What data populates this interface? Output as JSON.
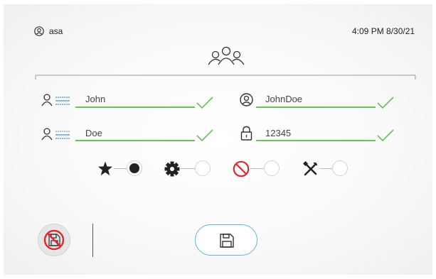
{
  "header": {
    "user_name": "asa",
    "datetime": "4:09 PM 8/30/21"
  },
  "form": {
    "first_name": "John",
    "last_name": "Doe",
    "username": "JohnDoe",
    "password": "12345"
  },
  "roles": {
    "selected": "star",
    "options": [
      "star-icon",
      "gear-icon",
      "no-entry-icon",
      "tools-icon"
    ]
  },
  "colors": {
    "valid_green": "#6abf5e",
    "accent_blue": "#5fb3e0",
    "deny_red": "#e0262f"
  }
}
